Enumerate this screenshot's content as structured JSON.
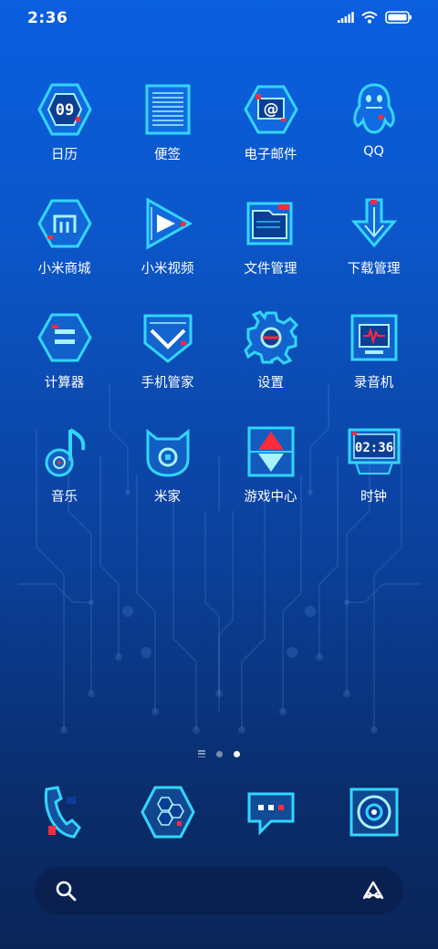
{
  "status_bar": {
    "time": "2:36",
    "icons": [
      "signal-icon",
      "wifi-icon",
      "battery-icon"
    ]
  },
  "apps": [
    {
      "label": "日历",
      "icon": "calendar-icon",
      "glyph": "09"
    },
    {
      "label": "便签",
      "icon": "notes-icon"
    },
    {
      "label": "电子邮件",
      "icon": "email-icon",
      "glyph": "@"
    },
    {
      "label": "QQ",
      "icon": "qq-penguin-icon"
    },
    {
      "label": "小米商城",
      "icon": "mi-store-icon"
    },
    {
      "label": "小米视频",
      "icon": "video-play-icon"
    },
    {
      "label": "文件管理",
      "icon": "folder-icon"
    },
    {
      "label": "下载管理",
      "icon": "download-arrow-icon"
    },
    {
      "label": "计算器",
      "icon": "calculator-icon"
    },
    {
      "label": "手机管家",
      "icon": "security-shield-icon"
    },
    {
      "label": "设置",
      "icon": "gear-icon"
    },
    {
      "label": "录音机",
      "icon": "recorder-icon"
    },
    {
      "label": "音乐",
      "icon": "music-note-icon"
    },
    {
      "label": "米家",
      "icon": "mijia-icon"
    },
    {
      "label": "游戏中心",
      "icon": "game-center-icon"
    },
    {
      "label": "时钟",
      "icon": "clock-icon",
      "glyph": "02:36"
    }
  ],
  "dock": [
    {
      "icon": "phone-icon"
    },
    {
      "icon": "contacts-hexagon-icon"
    },
    {
      "icon": "messages-bubble-icon"
    },
    {
      "icon": "camera-lens-icon"
    }
  ],
  "page_indicator": {
    "pages": 2,
    "active": 2
  },
  "search_bar": {
    "left_icon": "search-icon",
    "right_icon": "assistant-icon"
  },
  "colors": {
    "neon": "#32d6ff",
    "neon_light": "#a8f2ff",
    "accent_red": "#ff2a3a",
    "background_top": "#0a5fe0",
    "background_bottom": "#0a2558"
  }
}
